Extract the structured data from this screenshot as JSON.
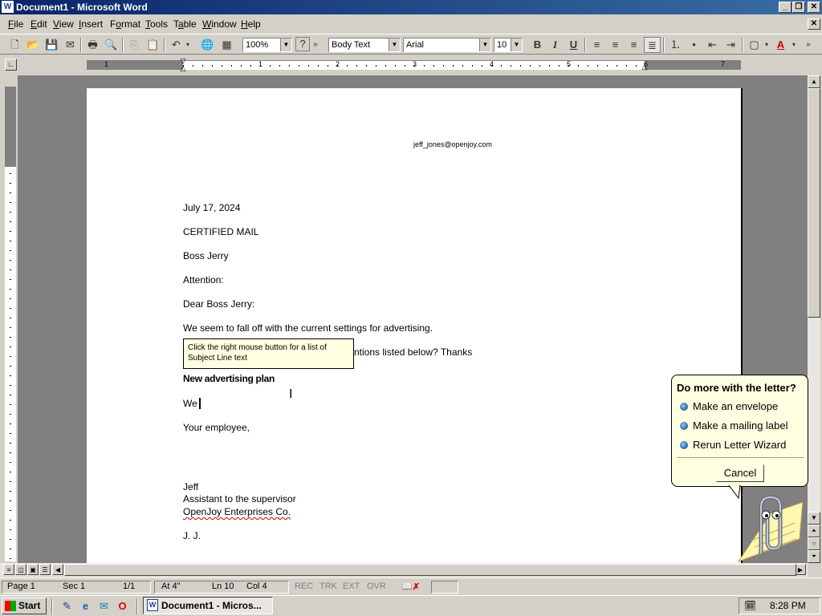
{
  "window": {
    "title": "Document1 - Microsoft Word",
    "app_icon": "W",
    "min": "_",
    "restore": "❐",
    "close": "✕"
  },
  "menu": [
    "File",
    "Edit",
    "View",
    "Insert",
    "Format",
    "Tools",
    "Table",
    "Window",
    "Help"
  ],
  "menu_accel": [
    "F",
    "E",
    "V",
    "I",
    "o",
    "T",
    "a",
    "W",
    "H"
  ],
  "toolbar": {
    "zoom": "100%",
    "style": "Body Text",
    "font": "Arial",
    "size": "10",
    "help": "?",
    "more": "»"
  },
  "ruler": {
    "marks": [
      "1",
      "1",
      "2",
      "3",
      "4",
      "5",
      "6",
      "7"
    ]
  },
  "document": {
    "header_email": "jeff_jones@openjoy.com",
    "date": "July 17, 2024",
    "certified": "CERTIFIED MAIL",
    "recipient": "Boss Jerry",
    "attention": "Attention:",
    "salutation": "Dear Boss Jerry:",
    "line1": "We seem to fall off with the current settings for advertising.",
    "line2_tail": "ntions listed below? Thanks",
    "subject": "New advertising plan",
    "body": "We",
    "closing": "Your employee,",
    "sig_name": "Jeff",
    "sig_title": "Assistant to the supervisor",
    "sig_company": "OpenJoy Enterprises Co.",
    "initials": "J. J."
  },
  "tooltip": {
    "text": "Click the right mouse button for a list of Subject Line text"
  },
  "balloon": {
    "title": "Do more with the letter?",
    "items": [
      "Make an envelope",
      "Make a mailing label",
      "Rerun Letter Wizard"
    ],
    "cancel": "Cancel"
  },
  "status": {
    "page": "Page 1",
    "sec": "Sec 1",
    "pages": "1/1",
    "at": "At 4\"",
    "ln": "Ln 10",
    "col": "Col 4",
    "rec": "REC",
    "trk": "TRK",
    "ext": "EXT",
    "ovr": "OVR"
  },
  "taskbar": {
    "start": "Start",
    "task": "Document1 - Micros...",
    "clock": "8:28 PM"
  }
}
